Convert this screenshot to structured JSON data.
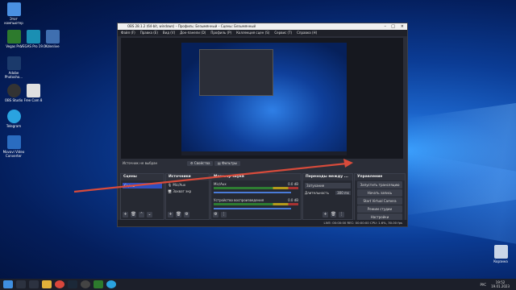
{
  "desktop": {
    "icons": [
      {
        "label": "Этот компьютер",
        "color": "#4a90e2"
      },
      {
        "label": "Vegas Pro",
        "color": "#2d7a2d"
      },
      {
        "label": "VEGAS Pro 19.0",
        "color": "#1a8fb3"
      },
      {
        "label": "Kdenlive",
        "color": "#3f6fb0"
      },
      {
        "label": "Adobe Photosho...",
        "color": "#1b3a6b"
      },
      {
        "label": "OBS Studio",
        "color": "#333333"
      },
      {
        "label": "Free Cam 8",
        "color": "#e0e0e0"
      },
      {
        "label": "Telegram",
        "color": "#2aa3e0"
      },
      {
        "label": "Movavi Video Converter",
        "color": "#2a6cc0"
      }
    ],
    "recycle_bin_label": "Корзина"
  },
  "obs": {
    "title": "OBS 28.1.2 (64-bit, windows) – Профиль: Безымянный – Сцены: Безымянный",
    "menu": [
      "Файл (F)",
      "Правка (E)",
      "Вид (V)",
      "Док-панели (D)",
      "Профиль (P)",
      "Коллекция сцен (S)",
      "Сервис (T)",
      "Справка (H)"
    ],
    "source_status": "Источник не выбран",
    "props_label": "Свойства",
    "filters_label": "Фильтры",
    "docks": {
      "scenes": {
        "title": "Сцены",
        "items": [
          "Сцена"
        ]
      },
      "sources": {
        "title": "Источники",
        "items": [
          "Mic/Aux",
          "Захват экр"
        ]
      },
      "mixer": {
        "title": "Микшер звука",
        "channels": [
          {
            "name": "Mic/Aux",
            "db": "0.0 dB"
          },
          {
            "name": "Устройство воспроизведения",
            "db": "0.0 dB"
          }
        ]
      },
      "transitions": {
        "title": "Переходы между ...",
        "selected": "Затухание",
        "duration_label": "Длительность",
        "duration_value": "300 ms"
      },
      "controls": {
        "title": "Управление",
        "buttons": [
          "Запустить трансляцию",
          "Начать запись",
          "Start Virtual Camera",
          "Режим студии",
          "Настройки",
          "Выход"
        ]
      }
    },
    "statusbar": "LIVE: 00:00:00   REC: 00:00:00   CPU: 1.6%, 30.00 fps"
  },
  "taskbar": {
    "icons": [
      "windows-start-icon",
      "search-icon",
      "task-view-icon",
      "explorer-icon",
      "chrome-icon",
      "steam-icon",
      "obs-icon",
      "vegas-icon",
      "telegram-icon"
    ],
    "tray": {
      "time": "19:52",
      "date": "19.01.2023",
      "lang": "РУС"
    }
  },
  "arrow_color": "#d84b3b"
}
